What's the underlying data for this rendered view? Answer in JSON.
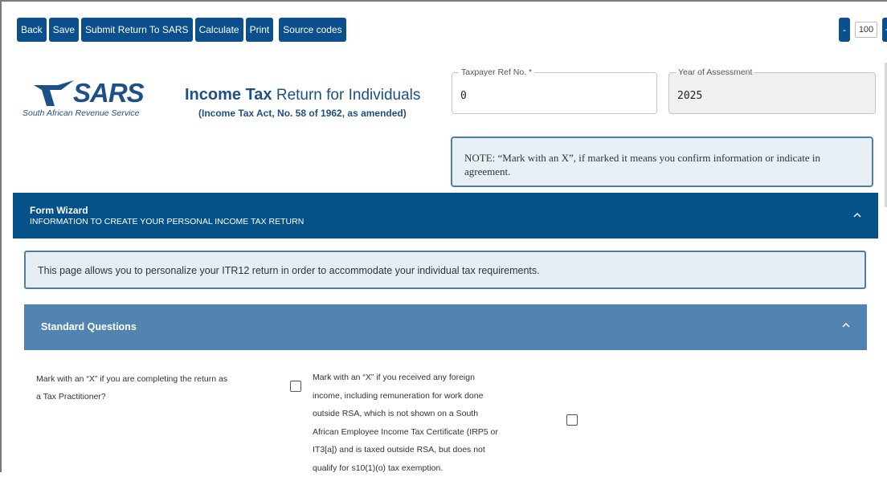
{
  "toolbar": {
    "back": "Back",
    "save": "Save",
    "submit": "Submit Return To SARS",
    "calculate": "Calculate",
    "print": "Print",
    "source_codes": "Source codes"
  },
  "zoom": {
    "minus": "-",
    "value": "100",
    "plus": "+"
  },
  "logo": {
    "word": "SARS",
    "subtitle": "South African Revenue Service"
  },
  "header": {
    "title_bold": "Income Tax",
    "title_rest": " Return for Individuals",
    "subtitle": "(Income Tax Act, No. 58 of 1962, as amended)"
  },
  "fields": {
    "taxpayer_ref": {
      "label": "Taxpayer Ref No. *",
      "value": "0"
    },
    "year": {
      "label": "Year of Assessment",
      "value": "2025"
    }
  },
  "note": "NOTE: “Mark with an X”, if marked it means you confirm information or indicate in agreement.",
  "wizard": {
    "title": "Form Wizard",
    "subtitle": "INFORMATION TO CREATE YOUR PERSONAL INCOME TAX RETURN"
  },
  "info": "This page allows you to personalize your ITR12 return in order to accommodate your individual tax requirements.",
  "standard_questions": {
    "title": "Standard Questions",
    "q1": "Mark with an “X” if you are completing the return as a Tax Practitioner?",
    "q2": "Mark with an “X” if you received any foreign income, including remuneration for work done outside RSA, which is not shown on a South African Employee Income Tax Certificate (IRP5 or IT3[a]) and is taxed outside RSA, but does not qualify for s10(1)(o) tax exemption."
  },
  "icons": {
    "wizard_toggle": "chevron-up-icon",
    "stdq_toggle": "chevron-up-icon",
    "logo_mark": "sars-logo-icon"
  },
  "colors": {
    "primary": "#0b4f8c",
    "wizard_bar": "#05528a",
    "section_bar": "#5284b1",
    "note_border": "#4d7fa3",
    "note_bg": "#e8f0f6",
    "brand_text": "#1d4f88"
  }
}
